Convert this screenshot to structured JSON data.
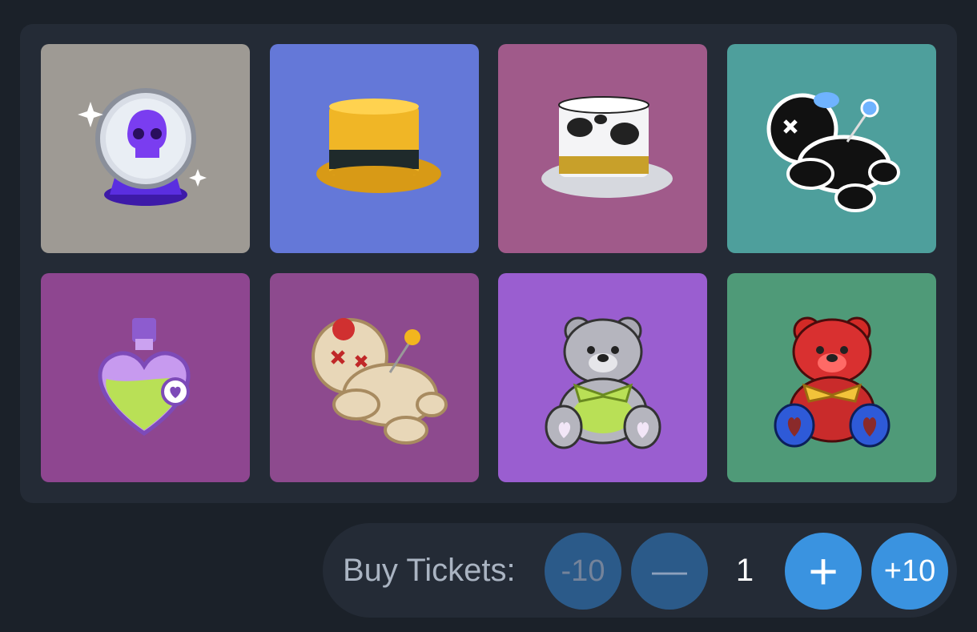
{
  "items": [
    {
      "name": "crystal-ball-skull",
      "icon": "crystal-ball-icon",
      "bg": "#9e9a94"
    },
    {
      "name": "gold-top-hat",
      "icon": "gold-top-hat-icon",
      "bg": "#6478d8"
    },
    {
      "name": "cow-top-hat",
      "icon": "cow-top-hat-icon",
      "bg": "#a05a8a"
    },
    {
      "name": "black-voodoo-doll",
      "icon": "black-voodoo-doll-icon",
      "bg": "#4e9f9c"
    },
    {
      "name": "love-potion",
      "icon": "heart-potion-icon",
      "bg": "#8e4690"
    },
    {
      "name": "voodoo-doll",
      "icon": "voodoo-doll-icon",
      "bg": "#8d4a8e"
    },
    {
      "name": "grey-teddy-bear",
      "icon": "grey-teddy-bear-icon",
      "bg": "#9a5ed0"
    },
    {
      "name": "red-teddy-bear",
      "icon": "red-teddy-bear-icon",
      "bg": "#4f9a78"
    }
  ],
  "buy": {
    "label": "Buy Tickets:",
    "minus10": "-10",
    "minus": "—",
    "quantity": "1",
    "plus": "+",
    "plus10": "+10"
  },
  "colors": {
    "page_bg": "#1b2129",
    "panel_bg": "#242b36",
    "button_dim": "#2b5a89",
    "button_bright": "#3a93e0"
  }
}
